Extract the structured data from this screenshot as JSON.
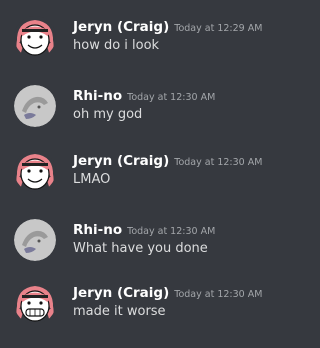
{
  "messages": [
    {
      "author": "Jeryn (Craig)",
      "timestamp": "Today at 12:29 AM",
      "text": "how do i look",
      "avatar": "jeryn-avatar-icon",
      "mouth": "smile"
    },
    {
      "author": "Rhi-no",
      "timestamp": "Today at 12:30 AM",
      "text": "oh my god",
      "avatar": "rhino-avatar-icon"
    },
    {
      "author": "Jeryn (Craig)",
      "timestamp": "Today at 12:30 AM",
      "text": "LMAO",
      "avatar": "jeryn-avatar-icon",
      "mouth": "smile"
    },
    {
      "author": "Rhi-no",
      "timestamp": "Today at 12:30 AM",
      "text": "What have you done",
      "avatar": "rhino-avatar-icon"
    },
    {
      "author": "Jeryn (Craig)",
      "timestamp": "Today at 12:30 AM",
      "text": "made it worse",
      "avatar": "jeryn-avatar-icon",
      "mouth": "grin"
    }
  ],
  "colors": {
    "background": "#36393f",
    "author": "#ffffff",
    "timestamp": "#a3a6aa",
    "text": "#dcddde",
    "jeryn_hair": "#e9828a",
    "rhino_avatar": "#c8c8c8"
  }
}
